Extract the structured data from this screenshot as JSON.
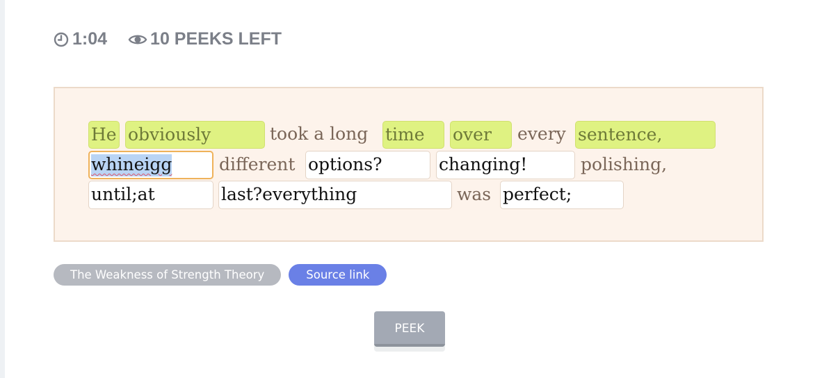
{
  "stats": {
    "timer": "1:04",
    "peeks": "10 PEEKS LEFT",
    "timer_icon": "clock-icon",
    "peeks_icon": "eye-icon"
  },
  "passage": {
    "words": [
      {
        "text": "He",
        "kind": "highlight"
      },
      {
        "text": "obviously",
        "kind": "highlight"
      },
      {
        "text": "took a long",
        "kind": "plain"
      },
      {
        "text": "time",
        "kind": "highlight"
      },
      {
        "text": "over",
        "kind": "highlight"
      },
      {
        "text": "every",
        "kind": "plain"
      },
      {
        "text": "sentence,",
        "kind": "highlight"
      },
      {
        "text": "whineigg",
        "kind": "input-active"
      },
      {
        "text": "different",
        "kind": "plain"
      },
      {
        "text": "options?",
        "kind": "input"
      },
      {
        "text": "changing!",
        "kind": "input"
      },
      {
        "text": "polishing,",
        "kind": "plain"
      },
      {
        "text": "until;at",
        "kind": "input"
      },
      {
        "text": "last?everything",
        "kind": "input"
      },
      {
        "text": "was",
        "kind": "plain"
      },
      {
        "text": "perfect;",
        "kind": "input"
      }
    ]
  },
  "tags": {
    "book": "The Weakness of Strength Theory",
    "source": "Source link"
  },
  "peek_button": "PEEK",
  "colors": {
    "highlight": "#dff282",
    "passage_bg": "#fdf3eb",
    "source_tag": "#6a80e6",
    "active_border": "#efb25a"
  }
}
